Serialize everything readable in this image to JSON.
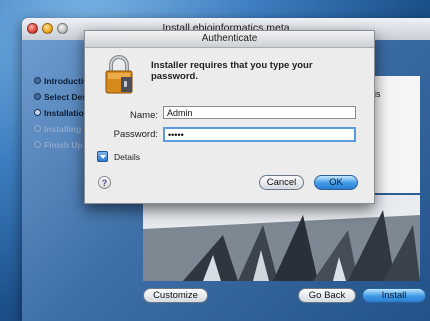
{
  "installer": {
    "title": "Install ebioinformatics meta",
    "steps": [
      {
        "label": "Introduction",
        "state": "done"
      },
      {
        "label": "Select Destination",
        "state": "done"
      },
      {
        "label": "Installation Type",
        "state": "current"
      },
      {
        "label": "Installing",
        "state": "pending"
      },
      {
        "label": "Finish Up",
        "state": "pending"
      }
    ],
    "pane_text_fragment": "is",
    "buttons": {
      "customize": "Customize",
      "go_back": "Go Back",
      "install": "Install"
    }
  },
  "auth_dialog": {
    "title": "Authenticate",
    "message": "Installer requires that you type your password.",
    "name_label": "Name:",
    "name_value": "Admin",
    "password_label": "Password:",
    "password_value": "•••••",
    "details_label": "Details",
    "help_glyph": "?",
    "cancel_label": "Cancel",
    "ok_label": "OK",
    "icon": "lock-icon"
  }
}
